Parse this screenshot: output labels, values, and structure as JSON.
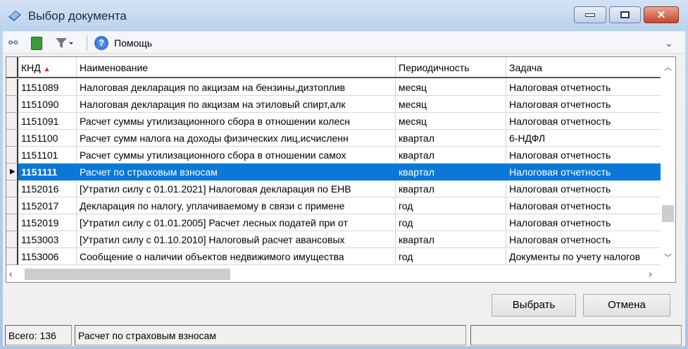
{
  "window": {
    "title": "Выбор документа"
  },
  "toolbar": {
    "help_label": "Помощь"
  },
  "grid": {
    "columns": [
      {
        "label": "КНД",
        "sort": "asc"
      },
      {
        "label": "Наименование"
      },
      {
        "label": "Периодичность"
      },
      {
        "label": "Задача"
      }
    ],
    "rows": [
      [
        "1151089",
        "Налоговая декларация по акцизам на бензины,дизтоплив",
        "месяц",
        "Налоговая отчетность"
      ],
      [
        "1151090",
        "Налоговая декларация по акцизам на этиловый спирт,алк",
        "месяц",
        "Налоговая отчетность"
      ],
      [
        "1151091",
        "Расчет суммы утилизационного сбора в отношении колесн",
        "месяц",
        "Налоговая отчетность"
      ],
      [
        "1151100",
        "Расчет сумм налога на доходы физических лиц,исчисленн",
        "квартал",
        "6-НДФЛ"
      ],
      [
        "1151101",
        "Расчет суммы утилизационного сбора в отношении самох",
        "квартал",
        "Налоговая отчетность"
      ],
      [
        "1151111",
        "Расчет по страховым взносам",
        "квартал",
        "Налоговая отчетность"
      ],
      [
        "1152016",
        "[Утратил силу с 01.01.2021] Налоговая декларация по ЕНВ",
        "квартал",
        "Налоговая отчетность"
      ],
      [
        "1152017",
        "Декларация по налогу, уплачиваемому в связи с примене",
        "год",
        "Налоговая отчетность"
      ],
      [
        "1152019",
        "[Утратил силу с 01.01.2005] Расчет лесных податей при от",
        "год",
        "Налоговая отчетность"
      ],
      [
        "1153003",
        "[Утратил силу с 01.10.2010] Налоговый расчет авансовых",
        "квартал",
        "Налоговая отчетность"
      ],
      [
        "1153006",
        "Сообщение о наличии объектов недвижимого имущества",
        "год",
        "Документы по учету налогов"
      ]
    ],
    "selected_index": 5
  },
  "buttons": {
    "select": "Выбрать",
    "cancel": "Отмена"
  },
  "status": {
    "total": "Всего: 136",
    "current": "Расчет по страховым взносам",
    "extra": ""
  },
  "colors": {
    "selection": "#0a78d7",
    "sort_arrow": "#e02020"
  }
}
